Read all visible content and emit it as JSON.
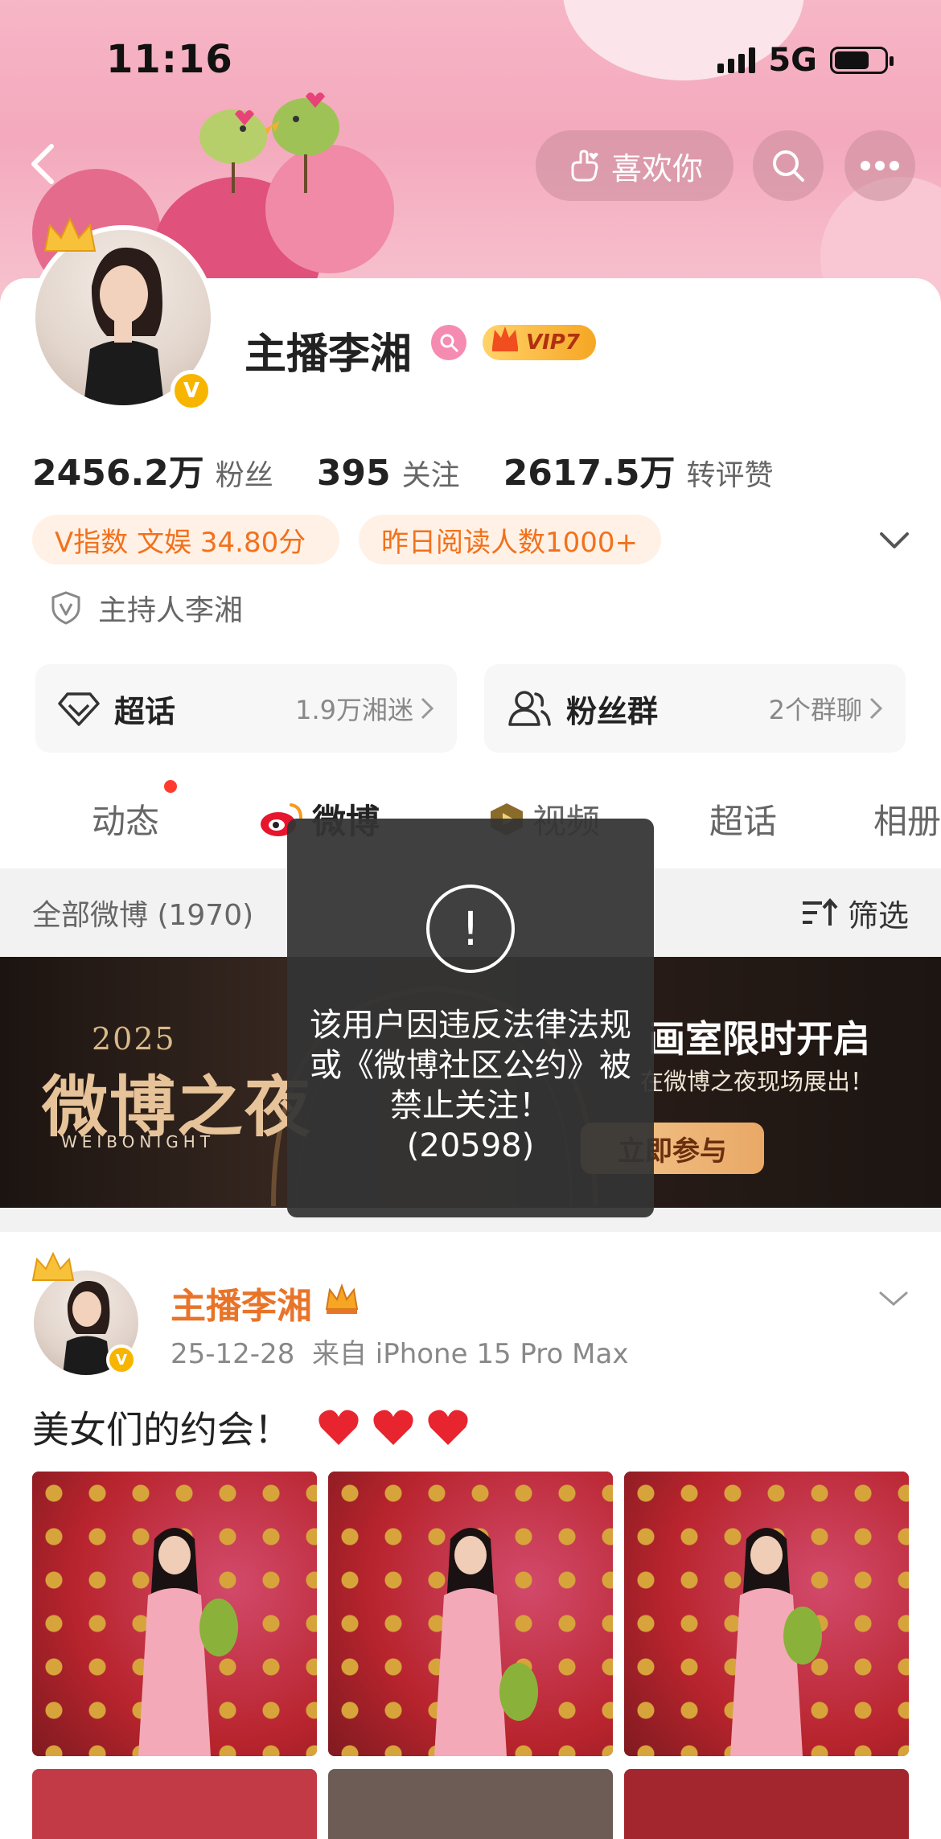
{
  "status_bar": {
    "time": "11:16",
    "network": "5G"
  },
  "header": {
    "like_label": "喜欢你"
  },
  "profile": {
    "name": "主播李湘",
    "vip_label": "VIP7",
    "stats": [
      {
        "value": "2456.2万",
        "label": "粉丝"
      },
      {
        "value": "395",
        "label": "关注"
      },
      {
        "value": "2617.5万",
        "label": "转评赞"
      }
    ],
    "tags": [
      "V指数 文娱 34.80分",
      "昨日阅读人数1000+"
    ],
    "certification": "主持人李湘",
    "entries": [
      {
        "title": "超话",
        "meta": "1.9万湘迷"
      },
      {
        "title": "粉丝群",
        "meta": "2个群聊"
      }
    ]
  },
  "tabs": [
    {
      "label": "动态"
    },
    {
      "label": "微博"
    },
    {
      "label": "视频"
    },
    {
      "label": "超话"
    },
    {
      "label": "相册"
    }
  ],
  "filter": {
    "label": "全部微博 (1970)",
    "button": "筛选"
  },
  "event_banner": {
    "year": "2025",
    "title": "微博之夜",
    "subtitle": "WEIBONIGHT",
    "headline": "画室限时开启",
    "description": "在微博之夜现场展出！",
    "button": "立即参与"
  },
  "post": {
    "author": "主播李湘",
    "date": "25-12-28",
    "source": "来自 iPhone 15 Pro Max",
    "text": "美女们的约会！"
  },
  "toast": {
    "message": "该用户因违反法律法规或《微博社区公约》被禁止关注！",
    "code": "(20598)"
  },
  "colors": {
    "accent_orange": "#e8742a",
    "vip_gold": "#f6a623",
    "banner_pink": "#f4a9bd"
  }
}
